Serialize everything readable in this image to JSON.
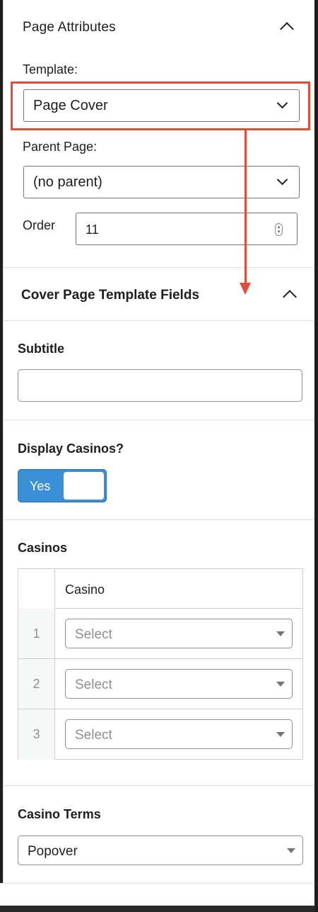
{
  "page_attributes": {
    "title": "Page Attributes",
    "template_label": "Template:",
    "template_value": "Page Cover",
    "parent_label": "Parent Page:",
    "parent_value": "(no parent)",
    "order_label": "Order",
    "order_value": "11"
  },
  "cover_fields": {
    "title": "Cover Page Template Fields",
    "subtitle_label": "Subtitle",
    "subtitle_value": "",
    "display_casinos_label": "Display Casinos?",
    "display_casinos_toggle": "Yes",
    "casinos_label": "Casinos",
    "casinos_column": "Casino",
    "casinos_rows": [
      {
        "num": "1",
        "value": "Select"
      },
      {
        "num": "2",
        "value": "Select"
      },
      {
        "num": "3",
        "value": "Select"
      }
    ],
    "casino_terms_label": "Casino Terms",
    "casino_terms_value": "Popover"
  },
  "colors": {
    "highlight": "#e24d3a",
    "toggle_on": "#3a8fd6"
  }
}
